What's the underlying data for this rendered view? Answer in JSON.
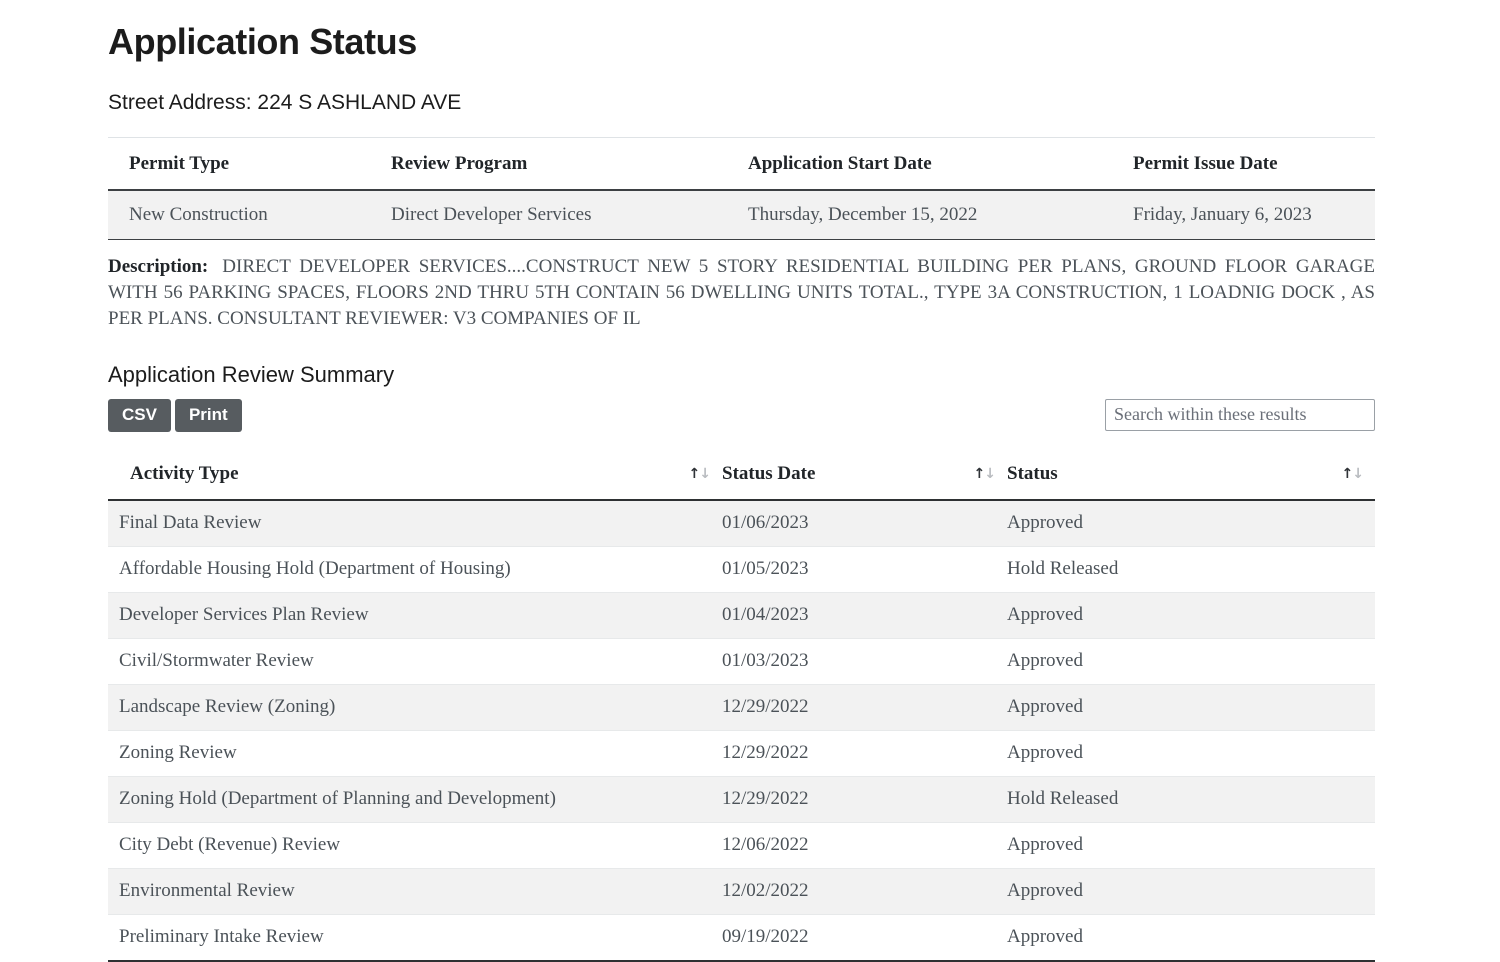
{
  "page": {
    "title": "Application Status",
    "street_address_label": "Street Address: 224 S ASHLAND AVE"
  },
  "permit_table": {
    "headers": {
      "permit_type": "Permit Type",
      "review_program": "Review Program",
      "application_start_date": "Application Start Date",
      "permit_issue_date": "Permit Issue Date"
    },
    "row": {
      "permit_type": "New Construction",
      "review_program": "Direct Developer Services",
      "application_start_date": "Thursday, December 15, 2022",
      "permit_issue_date": "Friday, January 6, 2023"
    }
  },
  "description": {
    "label": "Description:",
    "text": "DIRECT DEVELOPER SERVICES....CONSTRUCT NEW 5 STORY RESIDENTIAL BUILDING PER PLANS, GROUND FLOOR GARAGE WITH 56 PARKING SPACES, FLOORS 2ND THRU 5TH CONTAIN 56 DWELLING UNITS TOTAL., TYPE 3A CONSTRUCTION, 1 LOADNIG DOCK , AS PER PLANS. CONSULTANT REVIEWER: V3 COMPANIES OF IL"
  },
  "summary": {
    "title": "Application Review Summary",
    "buttons": {
      "csv": "CSV",
      "print": "Print"
    },
    "search": {
      "placeholder": "Search within these results",
      "value": ""
    },
    "headers": {
      "activity_type": "Activity Type",
      "status_date": "Status Date",
      "status": "Status"
    },
    "sort_icon": {
      "up": "↑",
      "down": "↓"
    },
    "rows": [
      {
        "activity_type": "Final Data Review",
        "status_date": "01/06/2023",
        "status": "Approved"
      },
      {
        "activity_type": "Affordable Housing Hold (Department of Housing)",
        "status_date": "01/05/2023",
        "status": "Hold Released"
      },
      {
        "activity_type": "Developer Services Plan Review",
        "status_date": "01/04/2023",
        "status": "Approved"
      },
      {
        "activity_type": "Civil/Stormwater Review",
        "status_date": "01/03/2023",
        "status": "Approved"
      },
      {
        "activity_type": "Landscape Review (Zoning)",
        "status_date": "12/29/2022",
        "status": "Approved"
      },
      {
        "activity_type": "Zoning Review",
        "status_date": "12/29/2022",
        "status": "Approved"
      },
      {
        "activity_type": "Zoning Hold (Department of Planning and Development)",
        "status_date": "12/29/2022",
        "status": "Hold Released"
      },
      {
        "activity_type": "City Debt (Revenue) Review",
        "status_date": "12/06/2022",
        "status": "Approved"
      },
      {
        "activity_type": "Environmental Review",
        "status_date": "12/02/2022",
        "status": "Approved"
      },
      {
        "activity_type": "Preliminary Intake Review",
        "status_date": "09/19/2022",
        "status": "Approved"
      }
    ]
  },
  "colors": {
    "button_bg": "#575c60",
    "row_alt_bg": "#f2f2f2",
    "text": "#4b5258",
    "heading": "#1c1c1c"
  }
}
